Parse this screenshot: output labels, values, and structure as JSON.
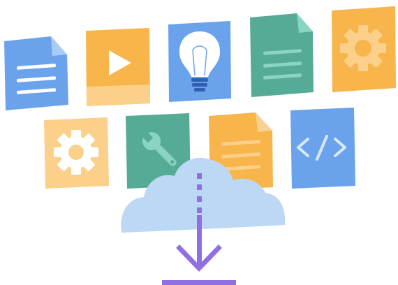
{
  "colors": {
    "blue": "#6aa3ec",
    "orange": "#f7b54b",
    "orange_light": "#fbd08a",
    "teal": "#56ab96",
    "teal_light": "#8ad4c4",
    "blue_fold": "#a9cbf6",
    "orange_fold": "#fbd190",
    "cloud": "#bcd8f5",
    "arrow": "#8f6fe1",
    "white": "#ffffff",
    "bulb_base": "#2f5fb3"
  },
  "tiles": [
    {
      "kind": "document",
      "icon": "document-lines-icon"
    },
    {
      "kind": "video",
      "icon": "play-icon"
    },
    {
      "kind": "idea",
      "icon": "lightbulb-icon"
    },
    {
      "kind": "document",
      "icon": "document-lines-icon"
    },
    {
      "kind": "settings",
      "icon": "gear-icon"
    },
    {
      "kind": "settings",
      "icon": "gear-icon"
    },
    {
      "kind": "tools",
      "icon": "wrench-icon"
    },
    {
      "kind": "document",
      "icon": "document-lines-icon"
    },
    {
      "kind": "code",
      "icon": "code-brackets-icon"
    }
  ],
  "cloud": {
    "icon": "cloud-icon"
  },
  "download": {
    "icon": "download-arrow-icon"
  }
}
